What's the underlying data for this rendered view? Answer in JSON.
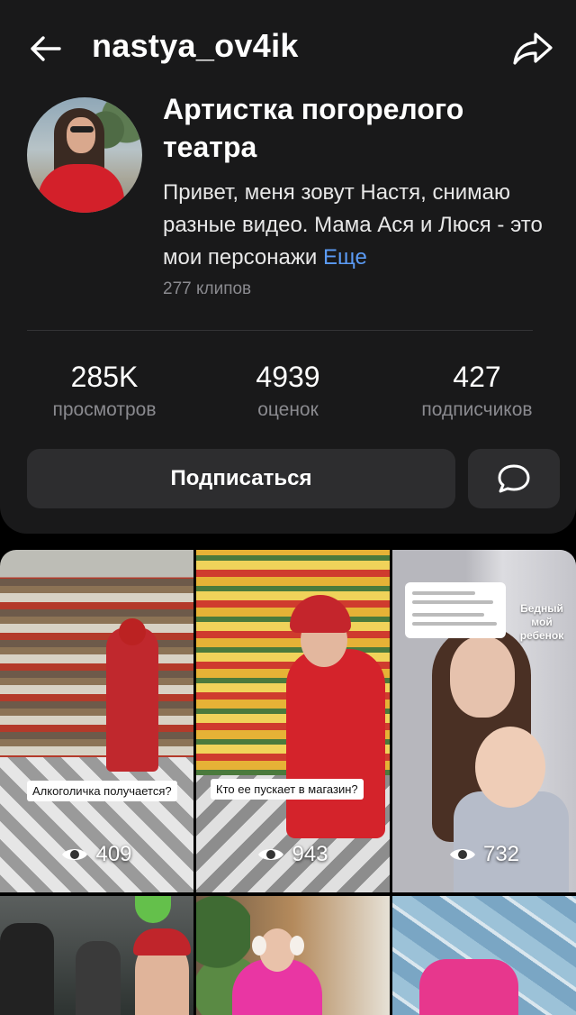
{
  "header": {
    "username": "nastya_ov4ik",
    "back_icon": "arrow-left-icon",
    "share_icon": "share-arrow-icon"
  },
  "profile": {
    "title": "Артистка погорелого театра",
    "bio": "Привет, меня зовут Настя, снимаю разные видео. Мама Ася и Люся - это мои персонажи",
    "more_label": "Еще",
    "clips_count": "277 клипов"
  },
  "stats": [
    {
      "value": "285K",
      "label": "просмотров"
    },
    {
      "value": "4939",
      "label": "оценок"
    },
    {
      "value": "427",
      "label": "подписчиков"
    }
  ],
  "actions": {
    "subscribe_label": "Подписаться",
    "message_icon": "chat-bubble-icon"
  },
  "clips": [
    {
      "views": "409",
      "caption": "Алкоголичка получается?"
    },
    {
      "views": "943",
      "caption": "Кто ее пускает в магазин?"
    },
    {
      "views": "732",
      "side_label": "Бедный мой ребенок"
    },
    {
      "views": ""
    },
    {
      "views": ""
    },
    {
      "views": ""
    }
  ],
  "colors": {
    "panel_bg": "#19191a",
    "button_bg": "#2d2d2f",
    "link": "#5b9bf5",
    "muted_text": "#8a8a8f"
  }
}
